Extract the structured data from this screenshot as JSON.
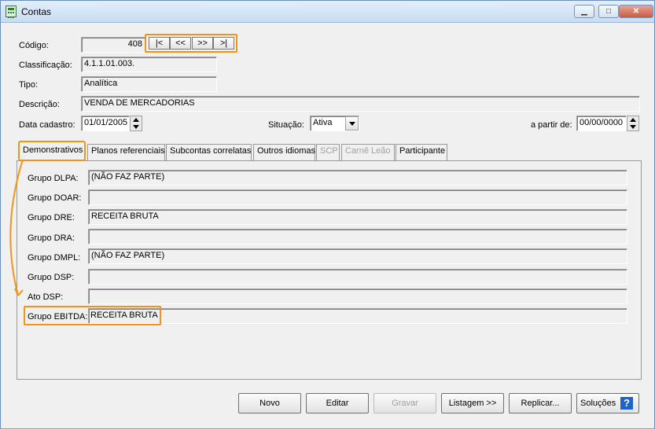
{
  "window": {
    "title": "Contas",
    "min": "▁",
    "max": "□",
    "close": "✕"
  },
  "form": {
    "codigo": {
      "label": "Código:",
      "value": "408"
    },
    "nav": {
      "first": "|<",
      "prev": "<<",
      "next": ">>",
      "last": ">|"
    },
    "classificacao": {
      "label": "Classificação:",
      "value": "4.1.1.01.003."
    },
    "tipo": {
      "label": "Tipo:",
      "value": "Analítica"
    },
    "descricao": {
      "label": "Descrição:",
      "value": "VENDA DE MERCADORIAS"
    },
    "data_cadastro": {
      "label": "Data cadastro:",
      "value": "01/01/2005"
    },
    "situacao": {
      "label": "Situação:",
      "value": "Ativa"
    },
    "a_partir_de": {
      "label": "a partir de:",
      "value": "00/00/0000"
    }
  },
  "tabs": [
    {
      "label": "Demonstrativos"
    },
    {
      "label": "Planos referenciais"
    },
    {
      "label": "Subcontas correlatas"
    },
    {
      "label": "Outros idiomas"
    },
    {
      "label": "SCP"
    },
    {
      "label": "Carnê Leão"
    },
    {
      "label": "Participante"
    }
  ],
  "groups": [
    {
      "label": "Grupo DLPA:",
      "value": "(NÃO FAZ PARTE)"
    },
    {
      "label": "Grupo DOAR:",
      "value": ""
    },
    {
      "label": "Grupo DRE:",
      "value": "RECEITA BRUTA"
    },
    {
      "label": "Grupo DRA:",
      "value": ""
    },
    {
      "label": "Grupo DMPL:",
      "value": "(NÃO FAZ PARTE)"
    },
    {
      "label": "Grupo DSP:",
      "value": ""
    },
    {
      "label": "Ato DSP:",
      "value": ""
    },
    {
      "label": "Grupo EBITDA:",
      "value": "RECEITA BRUTA"
    }
  ],
  "buttons": {
    "novo": "Novo",
    "editar": "Editar",
    "gravar": "Gravar",
    "listagem": "Listagem >>",
    "replicar": "Replicar...",
    "solucoes": "Soluções",
    "help": "?"
  },
  "colors": {
    "highlight": "#f29418",
    "help": "#1e63c8"
  }
}
